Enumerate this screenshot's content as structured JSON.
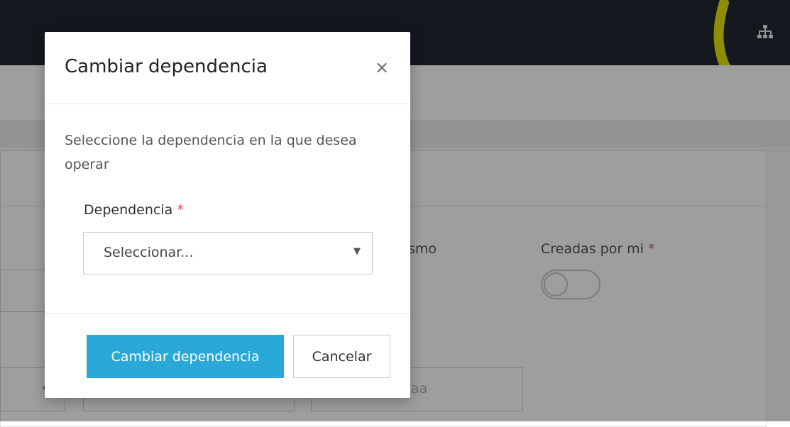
{
  "background": {
    "topbar_icon": "sitemap-icon",
    "fields": {
      "partial_label": "smo",
      "created_by_me_label": "Creadas por mi",
      "created_by_me_required": "*",
      "date_placeholder_partial": "aa"
    },
    "colors": {
      "topbar": "#1f2833",
      "highlight": "#e6e600"
    }
  },
  "modal": {
    "title": "Cambiar dependencia",
    "close_icon": "×",
    "description": "Seleccione la dependencia en la que desea operar",
    "field": {
      "label": "Dependencia",
      "required_mark": "*",
      "select_value": "Seleccionar...",
      "caret": "▼"
    },
    "buttons": {
      "confirm": "Cambiar dependencia",
      "cancel": "Cancelar"
    },
    "colors": {
      "primary": "#2aa8d8",
      "required": "#e0414e"
    }
  }
}
